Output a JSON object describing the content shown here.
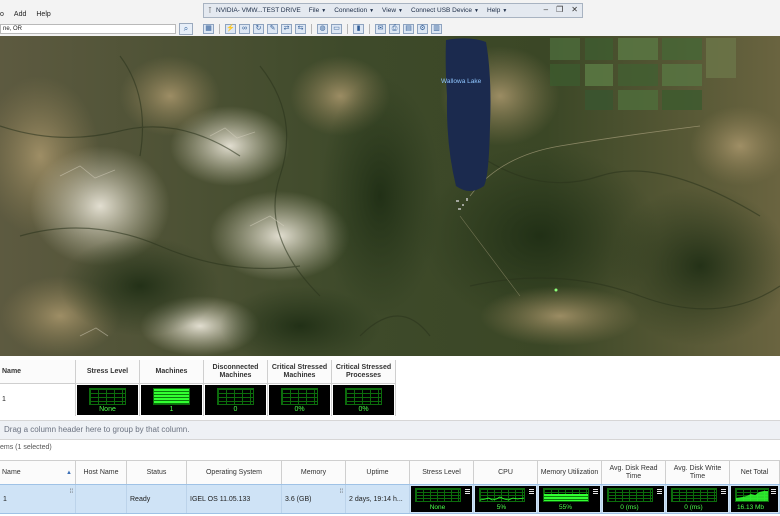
{
  "menu": [
    "o",
    "Add",
    "Help"
  ],
  "address": {
    "value": "ne, OR"
  },
  "remote_toolbar": {
    "title": "NVIDIA- VMW...TEST DRIVE",
    "items": [
      "File",
      "Connection",
      "View",
      "Connect USB Device",
      "Help"
    ]
  },
  "map": {
    "lake_label": "Wallowa Lake"
  },
  "summary": {
    "headers": [
      "Name",
      "Stress Level",
      "Machines",
      "Disconnected Machines",
      "Critical Stressed Machines",
      "Critical Stressed Processes"
    ],
    "row": {
      "name": "1",
      "stress_level": "None",
      "machines": "1",
      "disconnected": "0",
      "critical_machines": "0%",
      "critical_processes": "0%"
    }
  },
  "group_hint": "Drag a column header here to group by that column.",
  "item_count": "ems (1 selected)",
  "grid": {
    "headers": [
      "Name",
      "Host Name",
      "Status",
      "Operating System",
      "Memory",
      "Uptime",
      "Stress Level",
      "CPU",
      "Memory Utilization",
      "Avg. Disk Read Time",
      "Avg. Disk Write Time",
      "Net Total"
    ],
    "row": {
      "name": "1",
      "host_name": "",
      "status": "Ready",
      "os": "IGEL OS 11.05.133",
      "memory": "3.6 (GB)",
      "uptime": "2 days, 19:14 h...",
      "stress_level": "None",
      "cpu": "5%",
      "memory_util": "55%",
      "disk_read": "0 (ms)",
      "disk_write": "0 (ms)",
      "net_total": "16.13 Mb"
    }
  },
  "levels": {
    "machines_fill": 1.0,
    "memory_util": 0.55,
    "cpu": 0.05
  },
  "colors": {
    "gauge_green": "#32ff32",
    "selection": "#cfe3f6",
    "lake": "#1b2a4e"
  }
}
